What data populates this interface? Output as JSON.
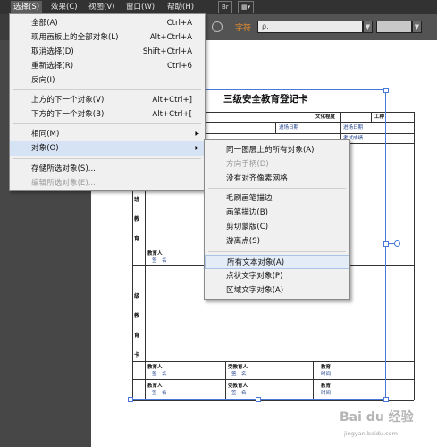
{
  "menubar": {
    "items": [
      "选择(S)",
      "效果(C)",
      "视图(V)",
      "窗口(W)",
      "帮助(H)"
    ],
    "active_index": 0,
    "badge_br": "Br",
    "badge_grid": "▦▾"
  },
  "controlbar": {
    "font_label": "字符",
    "font_value": "ρ.",
    "dropdown_glyph": "▼"
  },
  "document": {
    "title": "三级安全教育登记卡",
    "cells": {
      "culture": "文化程度",
      "jobtype": "工种",
      "date_in1": "进场日期",
      "date_in2": "进场日期",
      "exam": "考试成绩",
      "educator": "教育人",
      "signature": "签　名",
      "educatee": "受教育人",
      "edu_time": "教育",
      "time": "时间"
    },
    "vertical_left": [
      "班",
      "教",
      "育"
    ],
    "vertical_left2": [
      "级",
      "教",
      "育",
      "卡"
    ]
  },
  "select_menu": {
    "items": [
      {
        "label": "全部(A)",
        "shortcut": "Ctrl+A"
      },
      {
        "label": "现用画板上的全部对象(L)",
        "shortcut": "Alt+Ctrl+A"
      },
      {
        "label": "取消选择(D)",
        "shortcut": "Shift+Ctrl+A"
      },
      {
        "label": "重新选择(R)",
        "shortcut": "Ctrl+6"
      },
      {
        "label": "反向(I)",
        "shortcut": ""
      },
      {
        "label": "上方的下一个对象(V)",
        "shortcut": "Alt+Ctrl+]"
      },
      {
        "label": "下方的下一个对象(B)",
        "shortcut": "Alt+Ctrl+["
      },
      {
        "label": "相同(M)",
        "shortcut": ""
      },
      {
        "label": "对象(O)",
        "shortcut": ""
      },
      {
        "label": "存储所选对象(S)...",
        "shortcut": ""
      },
      {
        "label": "编辑所选对象(E)...",
        "shortcut": ""
      }
    ],
    "submenu_arrow": "▶"
  },
  "object_submenu": {
    "items": [
      {
        "label": "同一图层上的所有对象(A)"
      },
      {
        "label": "方向手柄(D)"
      },
      {
        "label": "没有对齐像素网格"
      },
      {
        "label": "毛刷画笔描边"
      },
      {
        "label": "画笔描边(B)"
      },
      {
        "label": "剪切蒙版(C)"
      },
      {
        "label": "游离点(S)"
      },
      {
        "label": "所有文本对象(A)"
      },
      {
        "label": "点状文字对象(P)"
      },
      {
        "label": "区域文字对象(A)"
      }
    ]
  },
  "watermark": {
    "logo": "Bai du 经验",
    "url": "jingyan.baidu.com"
  }
}
